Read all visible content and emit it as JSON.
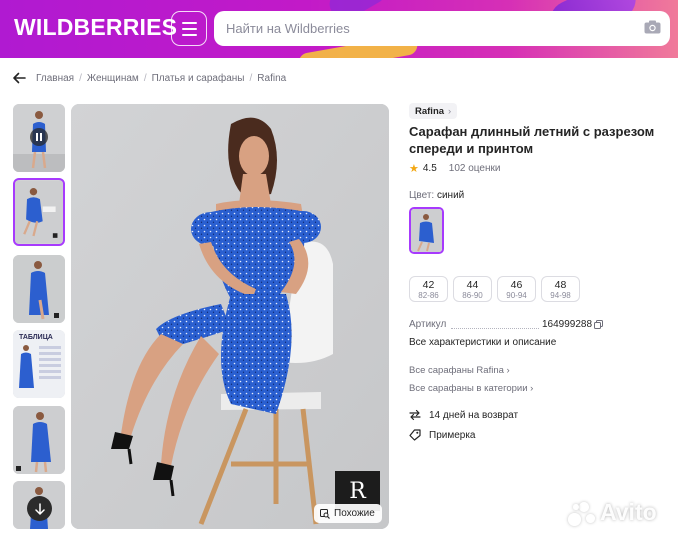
{
  "header": {
    "logo": "WILDBERRIES",
    "search_placeholder": "Найти на Wildberries",
    "brand_color": "#c21ac8"
  },
  "breadcrumbs": [
    "Главная",
    "Женщинам",
    "Платья и сарафаны",
    "Rafina"
  ],
  "gallery": {
    "thumbnails": [
      {
        "name": "thumb-video",
        "icon": "play-pause-icon"
      },
      {
        "name": "thumb-2",
        "selected": true
      },
      {
        "name": "thumb-3"
      },
      {
        "name": "thumb-size-table",
        "caption": "ТАБЛИЦА"
      },
      {
        "name": "thumb-5"
      },
      {
        "name": "thumb-6"
      }
    ],
    "scroll_icon": "arrow-down-icon",
    "watermark": "R",
    "similar_label": "Похожие"
  },
  "product": {
    "brand": "Rafina",
    "title": "Сарафан длинный летний с разрезом спереди и принтом",
    "rating": "4.5",
    "reviews": "102 оценки",
    "color_label": "Цвет:",
    "color_value": "синий",
    "sizes": [
      {
        "size": "42",
        "range": "82-86"
      },
      {
        "size": "44",
        "range": "86-90"
      },
      {
        "size": "46",
        "range": "90-94"
      },
      {
        "size": "48",
        "range": "94-98"
      }
    ],
    "sku_label": "Артикул",
    "sku_value": "164999288",
    "all_characteristics": "Все характеристики и описание",
    "links": [
      "Все сарафаны Rafina",
      "Все сарафаны в категории"
    ],
    "features": [
      {
        "icon": "return-arrows-icon",
        "text": "14 дней на возврат"
      },
      {
        "icon": "tag-icon",
        "text": "Примерка"
      }
    ]
  },
  "watermark_site": "Avito"
}
